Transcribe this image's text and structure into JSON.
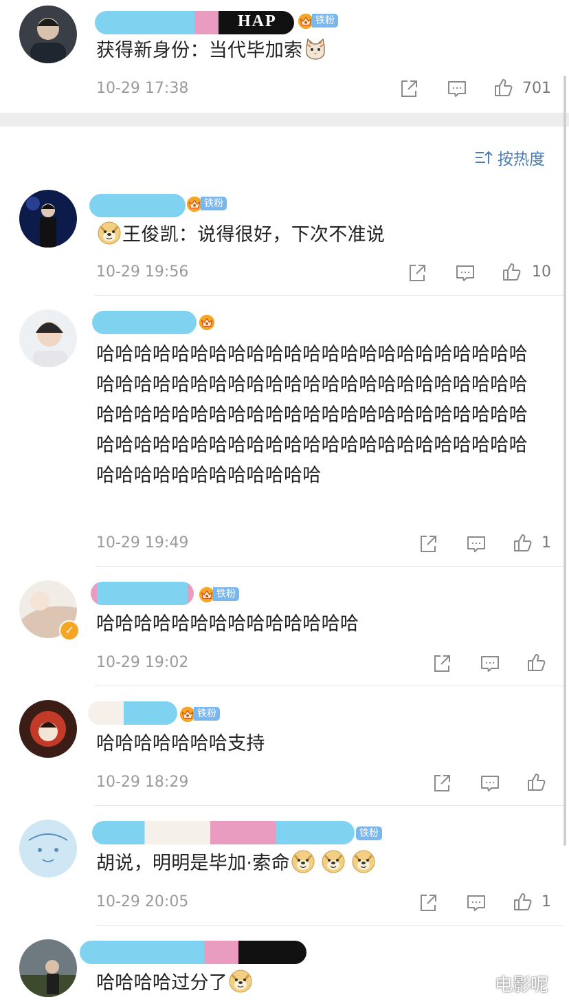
{
  "comments": [
    {
      "user_badge": "铁粉",
      "content_text": "获得新身份：当代毕加索",
      "content_emoji": "cat-emoji",
      "timestamp": "10-29 17:38",
      "likes": "701"
    },
    {
      "user_badge": "铁粉",
      "content_emoji": "doge-emoji",
      "content_text": "王俊凯：说得很好，下次不准说",
      "timestamp": "10-29 19:56",
      "likes": "10"
    },
    {
      "user_badge": "",
      "content_text": "哈哈哈哈哈哈哈哈哈哈哈哈哈哈哈哈哈哈哈哈哈哈哈哈哈哈哈哈哈哈哈哈哈哈哈哈哈哈哈哈哈哈哈哈哈哈哈哈哈哈哈哈哈哈哈哈哈哈哈哈哈哈哈哈哈哈哈哈哈哈哈哈哈哈哈哈哈哈哈哈哈哈哈哈哈哈哈哈哈哈哈哈哈哈哈哈哈哈哈哈哈哈哈哈",
      "timestamp": "10-29 19:49",
      "likes": "1"
    },
    {
      "user_badge": "铁粉",
      "content_text": "哈哈哈哈哈哈哈哈哈哈哈哈哈哈",
      "timestamp": "10-29 19:02",
      "likes": ""
    },
    {
      "user_badge": "铁粉",
      "content_text": "哈哈哈哈哈哈哈支持",
      "timestamp": "10-29 18:29",
      "likes": ""
    },
    {
      "user_badge": "铁粉",
      "content_text": "胡说，明明是毕加·索命",
      "content_emoji": "doge-emoji",
      "timestamp": "10-29 20:05",
      "likes": "1"
    },
    {
      "user_badge": "",
      "content_text": "哈哈哈哈过分了",
      "content_emoji": "doge-emoji",
      "timestamp": "",
      "likes": ""
    }
  ],
  "sort": {
    "label": "按热度",
    "icon": "sort-icon"
  },
  "watermark": "电影呢",
  "colors": {
    "badge_blue": "#79b7ef",
    "gray_text": "#9a9a9a",
    "separator": "#ededed"
  }
}
